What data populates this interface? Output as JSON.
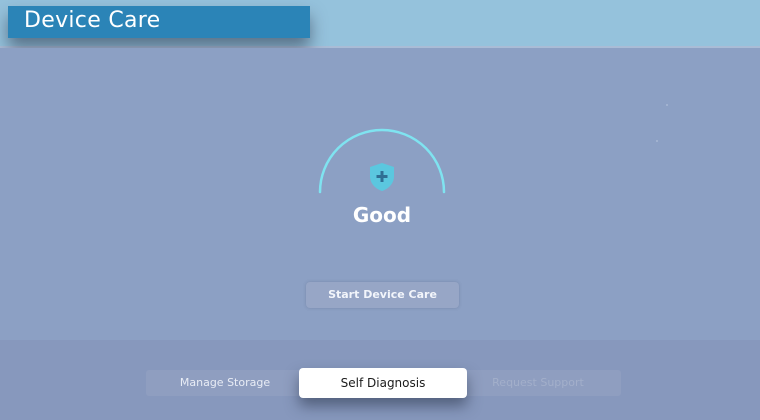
{
  "header": {
    "title": "Device Care"
  },
  "status": {
    "label": "Good",
    "icon": "shield-plus-icon"
  },
  "actions": {
    "start_label": "Start Device Care"
  },
  "tabs": [
    {
      "label": "Manage Storage",
      "selected": false
    },
    {
      "label": "Self Diagnosis",
      "selected": true
    },
    {
      "label": "Request Support",
      "selected": false
    }
  ],
  "colors": {
    "accent": "#2b84b7",
    "gauge": "#7fe3f0",
    "shield": "#5bc7df",
    "background": "#8ca0c4",
    "focus": "#ffffff"
  }
}
